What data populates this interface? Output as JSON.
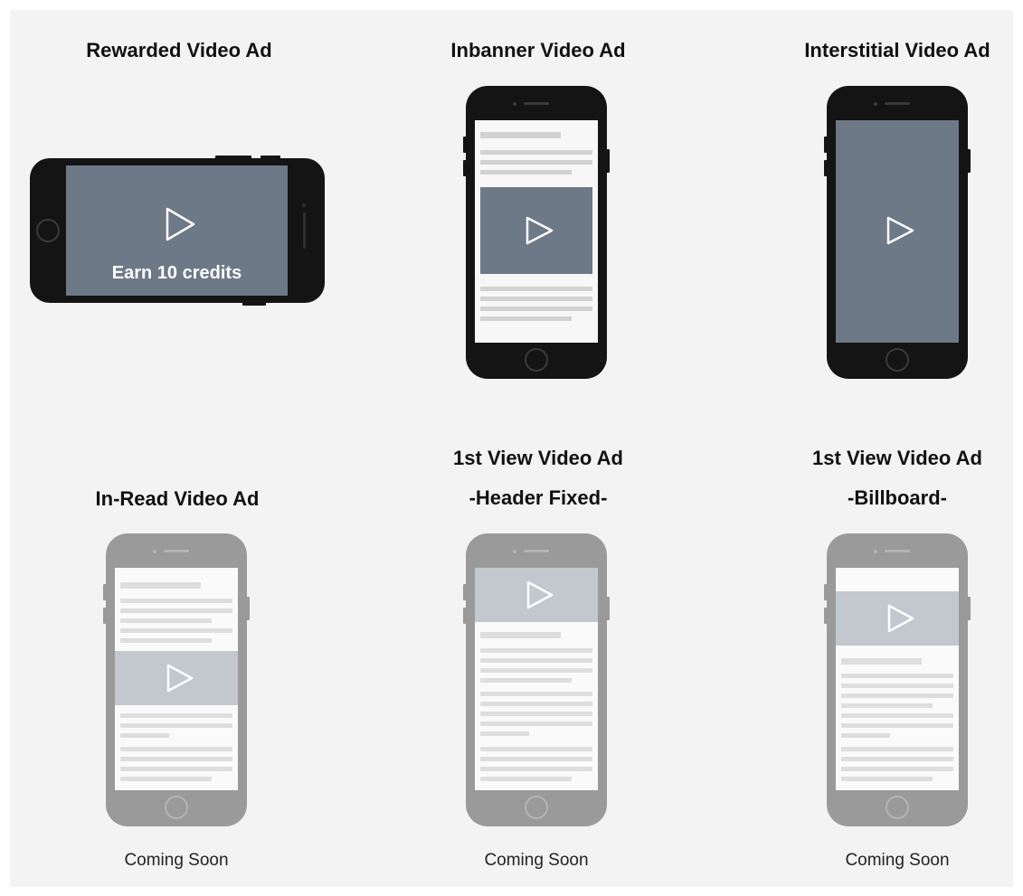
{
  "formats": [
    {
      "title": [
        "Rewarded Video Ad"
      ],
      "video_text": "Earn 10 credits"
    },
    {
      "title": [
        "Inbanner Video Ad"
      ]
    },
    {
      "title": [
        "Interstitial Video Ad"
      ]
    },
    {
      "title": [
        "In-Read Video Ad"
      ],
      "status": "Coming Soon"
    },
    {
      "title": [
        "1st View Video Ad",
        "-Header Fixed-"
      ],
      "status": "Coming Soon"
    },
    {
      "title": [
        "1st View Video Ad",
        "-Billboard-"
      ],
      "status": "Coming Soon"
    }
  ],
  "colors": {
    "background": "#f3f3f3",
    "phone_body": "#141414",
    "phone_body_disabled": "#9a9a9a",
    "video_area": "#6d7987",
    "video_area_disabled": "#c3c8cf",
    "content_line": "#d2d2d2",
    "content_line_disabled": "#dedede",
    "play_icon": "#ffffff"
  }
}
